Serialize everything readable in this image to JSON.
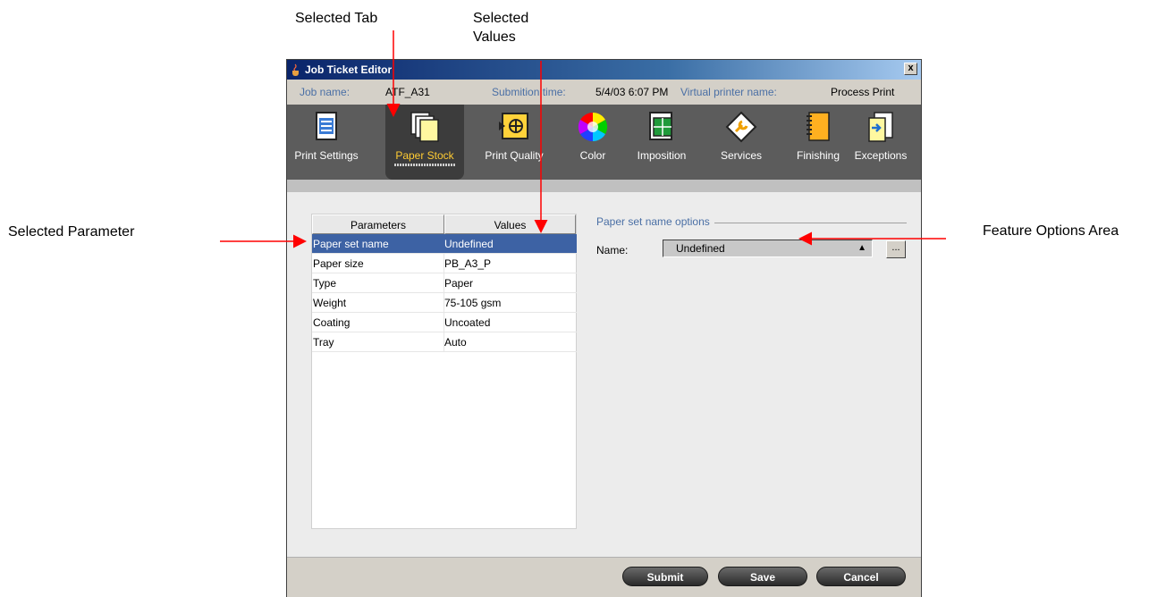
{
  "callouts": {
    "selected_tab": "Selected Tab",
    "selected_values_line1": "Selected",
    "selected_values_line2": "Values",
    "selected_parameter": "Selected Parameter",
    "feature_options_area": "Feature Options Area"
  },
  "window": {
    "title": "Job Ticket Editor",
    "close_label": "x"
  },
  "info": {
    "job_name_label": "Job name:",
    "job_name": "ATF_A31",
    "submission_time_label": "Submition time:",
    "submission_time": "5/4/03 6:07 PM",
    "virtual_printer_label": "Virtual printer name:",
    "virtual_printer": "Process Print"
  },
  "tabs": [
    {
      "label": "Print Settings",
      "icon": "print-settings-icon"
    },
    {
      "label": "Paper Stock",
      "icon": "paper-stock-icon",
      "selected": true
    },
    {
      "label": "Print Quality",
      "icon": "print-quality-icon"
    },
    {
      "label": "Color",
      "icon": "color-wheel-icon"
    },
    {
      "label": "Imposition",
      "icon": "imposition-icon"
    },
    {
      "label": "Services",
      "icon": "services-icon"
    },
    {
      "label": "Finishing",
      "icon": "finishing-icon"
    },
    {
      "label": "Exceptions",
      "icon": "exceptions-icon"
    }
  ],
  "table": {
    "headers": [
      "Parameters",
      "Values"
    ],
    "rows": [
      {
        "param": "Paper set name",
        "value": "Undefined",
        "selected": true
      },
      {
        "param": "Paper size",
        "value": "PB_A3_P"
      },
      {
        "param": "Type",
        "value": "Paper"
      },
      {
        "param": "Weight",
        "value": "75-105 gsm"
      },
      {
        "param": "Coating",
        "value": "Uncoated"
      },
      {
        "param": "Tray",
        "value": "Auto"
      }
    ]
  },
  "options": {
    "title": "Paper set name options",
    "name_label": "Name:",
    "name_value": "Undefined",
    "more_label": "..."
  },
  "buttons": {
    "submit": "Submit",
    "save": "Save",
    "cancel": "Cancel"
  },
  "colors": {
    "title_gradient_start": "#0a246a",
    "selection": "#3d62a4",
    "selected_tab_text": "#ffcc33",
    "arrow": "#ff0000"
  }
}
